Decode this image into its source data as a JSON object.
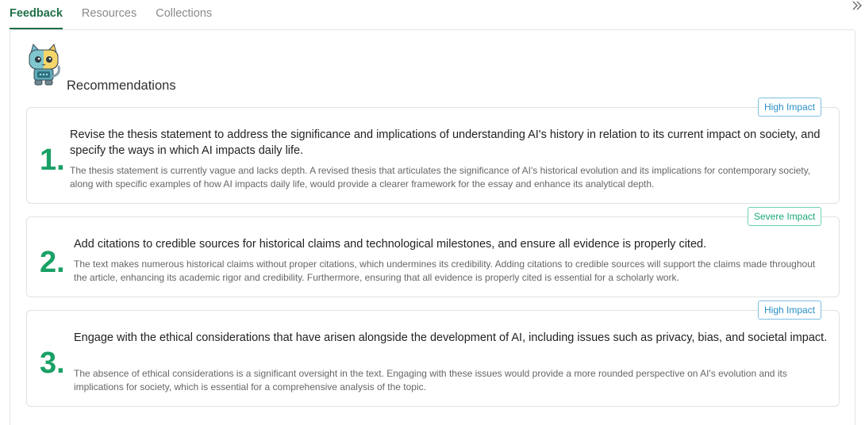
{
  "tabs": [
    {
      "label": "Feedback",
      "active": true
    },
    {
      "label": "Resources",
      "active": false
    },
    {
      "label": "Collections",
      "active": false
    }
  ],
  "collapse_icon": "double-chevron-right-icon",
  "header": {
    "title": "Recommendations",
    "mascot_icon": "robot-cat-mascot"
  },
  "recommendations": [
    {
      "number": "1.",
      "badge": "High Impact",
      "badge_type": "high",
      "title": "Revise the thesis statement to address the significance and implications of understanding AI's history in relation to its current impact on society, and specify the ways in which AI impacts daily life.",
      "description": "The thesis statement is currently vague and lacks depth. A revised thesis that articulates the significance of AI's historical evolution and its implications for contemporary society, along with specific examples of how AI impacts daily life, would provide a clearer framework for the essay and enhance its analytical depth."
    },
    {
      "number": "2.",
      "badge": "Severe Impact",
      "badge_type": "severe",
      "title": "Add citations to credible sources for historical claims and technological milestones, and ensure all evidence is properly cited.",
      "description": "The text makes numerous historical claims without proper citations, which undermines its credibility. Adding citations to credible sources will support the claims made throughout the article, enhancing its academic rigor and credibility. Furthermore, ensuring that all evidence is properly cited is essential for a scholarly work."
    },
    {
      "number": "3.",
      "badge": "High Impact",
      "badge_type": "high",
      "title": "Engage with the ethical considerations that have arisen alongside the development of AI, including issues such as privacy, bias, and societal impact.",
      "description": "The absence of ethical considerations is a significant oversight in the text. Engaging with these issues would provide a more rounded perspective on AI's evolution and its implications for society, which is essential for a comprehensive analysis of the topic."
    }
  ],
  "colors": {
    "accent": "#1f6f45",
    "number": "#1aa066",
    "high_badge": "#2a8fc7",
    "severe_badge": "#1aa879"
  }
}
